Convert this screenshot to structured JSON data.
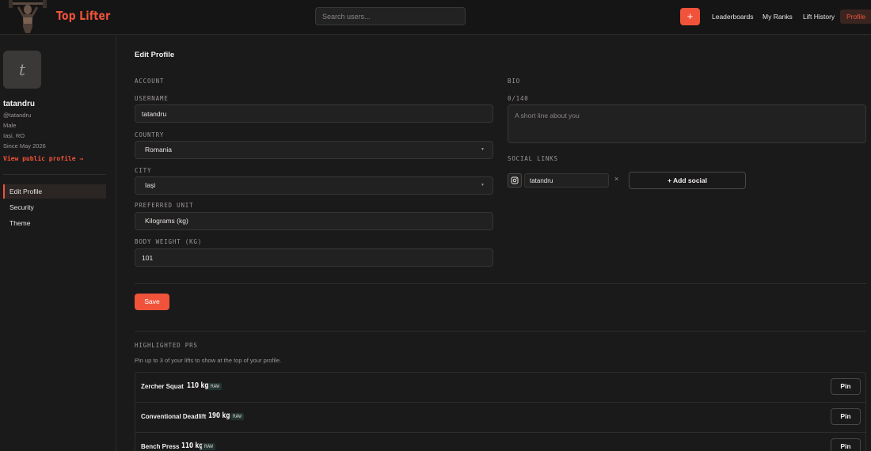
{
  "header": {
    "brand": "Top Lifter",
    "search_placeholder": "Search users...",
    "add_label": "+",
    "nav": [
      "Leaderboards",
      "My Ranks",
      "Lift History",
      "Profile"
    ]
  },
  "sidebar": {
    "avatar_letter": "t",
    "name": "tatandru",
    "handle": "@tatandru",
    "gender": "Male",
    "location": "Iași, RO",
    "since": "Since May 2026",
    "public_link": "View public profile →",
    "items": [
      "Edit Profile",
      "Security",
      "Theme"
    ]
  },
  "main": {
    "title": "Edit Profile",
    "account_label": "ACCOUNT",
    "username_label": "USERNAME",
    "username_value": "tatandru",
    "country_label": "COUNTRY",
    "country_value": "Romania",
    "city_label": "CITY",
    "city_value": "Iași",
    "unit_label": "PREFERRED UNIT",
    "unit_value": "Kilograms (kg)",
    "bodyweight_label": "BODY WEIGHT (KG)",
    "bodyweight_value": "101",
    "bio_label": "BIO",
    "bio_counter": "0/140",
    "bio_placeholder": "A short line about you",
    "social_label": "SOCIAL LINKS",
    "social_value": "tatandru",
    "social_remove": "×",
    "add_social": "+ Add social",
    "save": "Save"
  },
  "prs": {
    "label": "HIGHLIGHTED PRS",
    "hint": "Pin up to 3 of your lifts to show at the top of your profile.",
    "pin_label": "Pin",
    "rows": [
      {
        "name": "Zercher Squat",
        "weight": "110 kg",
        "badge": "RAW"
      },
      {
        "name": "Conventional Deadlift",
        "weight": "190 kg",
        "badge": "RAW"
      },
      {
        "name": "Bench Press",
        "weight": "110 kg",
        "badge": "RAW"
      }
    ]
  },
  "colors": {
    "accent": "#f0533a",
    "background": "#1b1a1a",
    "surface": "#222121"
  },
  "icons": [
    "lifter-logo",
    "chevron-down-icon",
    "instagram-icon",
    "close-icon",
    "plus-icon"
  ]
}
